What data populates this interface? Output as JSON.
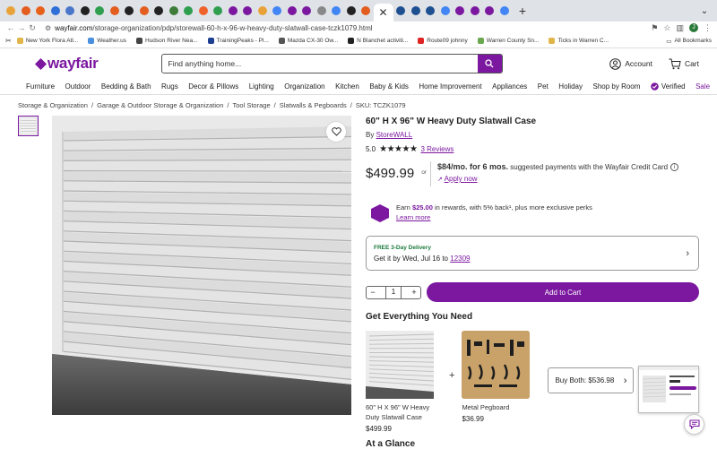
{
  "browser": {
    "url_prefix": "wayfair.com",
    "url_path": "/storage-organization/pdp/storewall-60-h-x-96-w-heavy-duty-slatwall-case-tczk1079.html",
    "tab_colors": [
      "#e8a23a",
      "#e35d1f",
      "#e8611a",
      "#2f6fd8",
      "#4a76c9",
      "#222222",
      "#2f9e4f",
      "#e35d1f",
      "#222222",
      "#e35d1f",
      "#222222",
      "#3d7c3a",
      "#2f9e4f",
      "#f0622c",
      "#2f9e4f",
      "#7b189f",
      "#7b189f",
      "#e8a23a",
      "#4285f4",
      "#7b189f",
      "#7b189f",
      "#888888",
      "#4285f4",
      "#222222",
      "#e35d1f",
      "#1d4f91",
      "#1d4f91",
      "#1d4f91",
      "#4285f4",
      "#7b189f",
      "#7b189f",
      "#7b189f",
      "#4285f4"
    ],
    "bookmarks": [
      {
        "label": "New York Flora Atl...",
        "color": "#e0b64a"
      },
      {
        "label": "Weather.us",
        "color": "#4a8fe0"
      },
      {
        "label": "Hudson River Nea...",
        "color": "#444444"
      },
      {
        "label": "TrainingPeaks - Pl...",
        "color": "#1d3f91"
      },
      {
        "label": "Mazda CX-30 Ow...",
        "color": "#555555"
      },
      {
        "label": "N Blanchet activiti...",
        "color": "#222222"
      },
      {
        "label": "Route09 johnny",
        "color": "#e02424"
      },
      {
        "label": "Warren County Sn...",
        "color": "#6aa84f"
      },
      {
        "label": "Ticks in Warren C...",
        "color": "#e0b64a"
      }
    ],
    "all_bookmarks": "All Bookmarks"
  },
  "header": {
    "logo": "wayfair",
    "search_placeholder": "Find anything home...",
    "account": "Account",
    "cart": "Cart"
  },
  "categories": [
    "Furniture",
    "Outdoor",
    "Bedding & Bath",
    "Rugs",
    "Decor & Pillows",
    "Lighting",
    "Organization",
    "Kitchen",
    "Baby & Kids",
    "Home Improvement",
    "Appliances",
    "Pet",
    "Holiday",
    "Shop by Room"
  ],
  "verified": "Verified",
  "sale": "Sale",
  "breadcrumbs": [
    "Storage & Organization",
    "Garage & Outdoor Storage & Organization",
    "Tool Storage",
    "Slatwalls & Pegboards"
  ],
  "sku": "SKU: TCZK1079",
  "product": {
    "title": "60\" H X 96\" W Heavy Duty Slatwall Case",
    "by": "By",
    "brand": "StoreWALL",
    "rating": "5.0",
    "stars": 5,
    "reviews": "3 Reviews",
    "price": "$499.99",
    "or": "or",
    "monthly": "$84/mo. for 6 mos.",
    "finance_text": "suggested payments with the Wayfair Credit Card",
    "apply": "Apply now",
    "rewards_pre": "Earn",
    "rewards_amount": "$25.00",
    "rewards_post": "in rewards, with 5% back¹, plus more exclusive perks",
    "learn_more": "Learn more",
    "delivery_badge": "FREE 3-Day Delivery",
    "delivery_when": "Get it by Wed, Jul 16 to",
    "zip": "12309",
    "qty": "1",
    "add_to_cart": "Add to Cart"
  },
  "bundle": {
    "heading": "Get Everything You Need",
    "items": [
      {
        "name": "60\" H X 96\" W Heavy Duty Slatwall Case",
        "price": "$499.99"
      },
      {
        "name": "Metal Pegboard",
        "price": "$36.99"
      }
    ],
    "buy_both": "Buy Both: $536.98"
  },
  "glance": "At a Glance"
}
